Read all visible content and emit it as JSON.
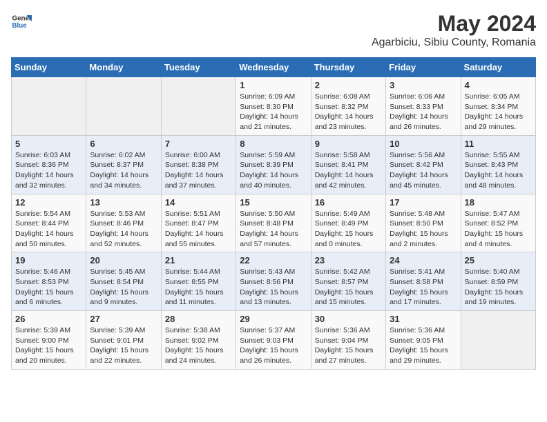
{
  "logo": {
    "general": "General",
    "blue": "Blue"
  },
  "title": "May 2024",
  "subtitle": "Agarbiciu, Sibiu County, Romania",
  "days_of_week": [
    "Sunday",
    "Monday",
    "Tuesday",
    "Wednesday",
    "Thursday",
    "Friday",
    "Saturday"
  ],
  "weeks": [
    [
      {
        "day": "",
        "content": ""
      },
      {
        "day": "",
        "content": ""
      },
      {
        "day": "",
        "content": ""
      },
      {
        "day": "1",
        "content": "Sunrise: 6:09 AM\nSunset: 8:30 PM\nDaylight: 14 hours and 21 minutes."
      },
      {
        "day": "2",
        "content": "Sunrise: 6:08 AM\nSunset: 8:32 PM\nDaylight: 14 hours and 23 minutes."
      },
      {
        "day": "3",
        "content": "Sunrise: 6:06 AM\nSunset: 8:33 PM\nDaylight: 14 hours and 26 minutes."
      },
      {
        "day": "4",
        "content": "Sunrise: 6:05 AM\nSunset: 8:34 PM\nDaylight: 14 hours and 29 minutes."
      }
    ],
    [
      {
        "day": "5",
        "content": "Sunrise: 6:03 AM\nSunset: 8:36 PM\nDaylight: 14 hours and 32 minutes."
      },
      {
        "day": "6",
        "content": "Sunrise: 6:02 AM\nSunset: 8:37 PM\nDaylight: 14 hours and 34 minutes."
      },
      {
        "day": "7",
        "content": "Sunrise: 6:00 AM\nSunset: 8:38 PM\nDaylight: 14 hours and 37 minutes."
      },
      {
        "day": "8",
        "content": "Sunrise: 5:59 AM\nSunset: 8:39 PM\nDaylight: 14 hours and 40 minutes."
      },
      {
        "day": "9",
        "content": "Sunrise: 5:58 AM\nSunset: 8:41 PM\nDaylight: 14 hours and 42 minutes."
      },
      {
        "day": "10",
        "content": "Sunrise: 5:56 AM\nSunset: 8:42 PM\nDaylight: 14 hours and 45 minutes."
      },
      {
        "day": "11",
        "content": "Sunrise: 5:55 AM\nSunset: 8:43 PM\nDaylight: 14 hours and 48 minutes."
      }
    ],
    [
      {
        "day": "12",
        "content": "Sunrise: 5:54 AM\nSunset: 8:44 PM\nDaylight: 14 hours and 50 minutes."
      },
      {
        "day": "13",
        "content": "Sunrise: 5:53 AM\nSunset: 8:46 PM\nDaylight: 14 hours and 52 minutes."
      },
      {
        "day": "14",
        "content": "Sunrise: 5:51 AM\nSunset: 8:47 PM\nDaylight: 14 hours and 55 minutes."
      },
      {
        "day": "15",
        "content": "Sunrise: 5:50 AM\nSunset: 8:48 PM\nDaylight: 14 hours and 57 minutes."
      },
      {
        "day": "16",
        "content": "Sunrise: 5:49 AM\nSunset: 8:49 PM\nDaylight: 15 hours and 0 minutes."
      },
      {
        "day": "17",
        "content": "Sunrise: 5:48 AM\nSunset: 8:50 PM\nDaylight: 15 hours and 2 minutes."
      },
      {
        "day": "18",
        "content": "Sunrise: 5:47 AM\nSunset: 8:52 PM\nDaylight: 15 hours and 4 minutes."
      }
    ],
    [
      {
        "day": "19",
        "content": "Sunrise: 5:46 AM\nSunset: 8:53 PM\nDaylight: 15 hours and 6 minutes."
      },
      {
        "day": "20",
        "content": "Sunrise: 5:45 AM\nSunset: 8:54 PM\nDaylight: 15 hours and 9 minutes."
      },
      {
        "day": "21",
        "content": "Sunrise: 5:44 AM\nSunset: 8:55 PM\nDaylight: 15 hours and 11 minutes."
      },
      {
        "day": "22",
        "content": "Sunrise: 5:43 AM\nSunset: 8:56 PM\nDaylight: 15 hours and 13 minutes."
      },
      {
        "day": "23",
        "content": "Sunrise: 5:42 AM\nSunset: 8:57 PM\nDaylight: 15 hours and 15 minutes."
      },
      {
        "day": "24",
        "content": "Sunrise: 5:41 AM\nSunset: 8:58 PM\nDaylight: 15 hours and 17 minutes."
      },
      {
        "day": "25",
        "content": "Sunrise: 5:40 AM\nSunset: 8:59 PM\nDaylight: 15 hours and 19 minutes."
      }
    ],
    [
      {
        "day": "26",
        "content": "Sunrise: 5:39 AM\nSunset: 9:00 PM\nDaylight: 15 hours and 20 minutes."
      },
      {
        "day": "27",
        "content": "Sunrise: 5:39 AM\nSunset: 9:01 PM\nDaylight: 15 hours and 22 minutes."
      },
      {
        "day": "28",
        "content": "Sunrise: 5:38 AM\nSunset: 9:02 PM\nDaylight: 15 hours and 24 minutes."
      },
      {
        "day": "29",
        "content": "Sunrise: 5:37 AM\nSunset: 9:03 PM\nDaylight: 15 hours and 26 minutes."
      },
      {
        "day": "30",
        "content": "Sunrise: 5:36 AM\nSunset: 9:04 PM\nDaylight: 15 hours and 27 minutes."
      },
      {
        "day": "31",
        "content": "Sunrise: 5:36 AM\nSunset: 9:05 PM\nDaylight: 15 hours and 29 minutes."
      },
      {
        "day": "",
        "content": ""
      }
    ]
  ]
}
